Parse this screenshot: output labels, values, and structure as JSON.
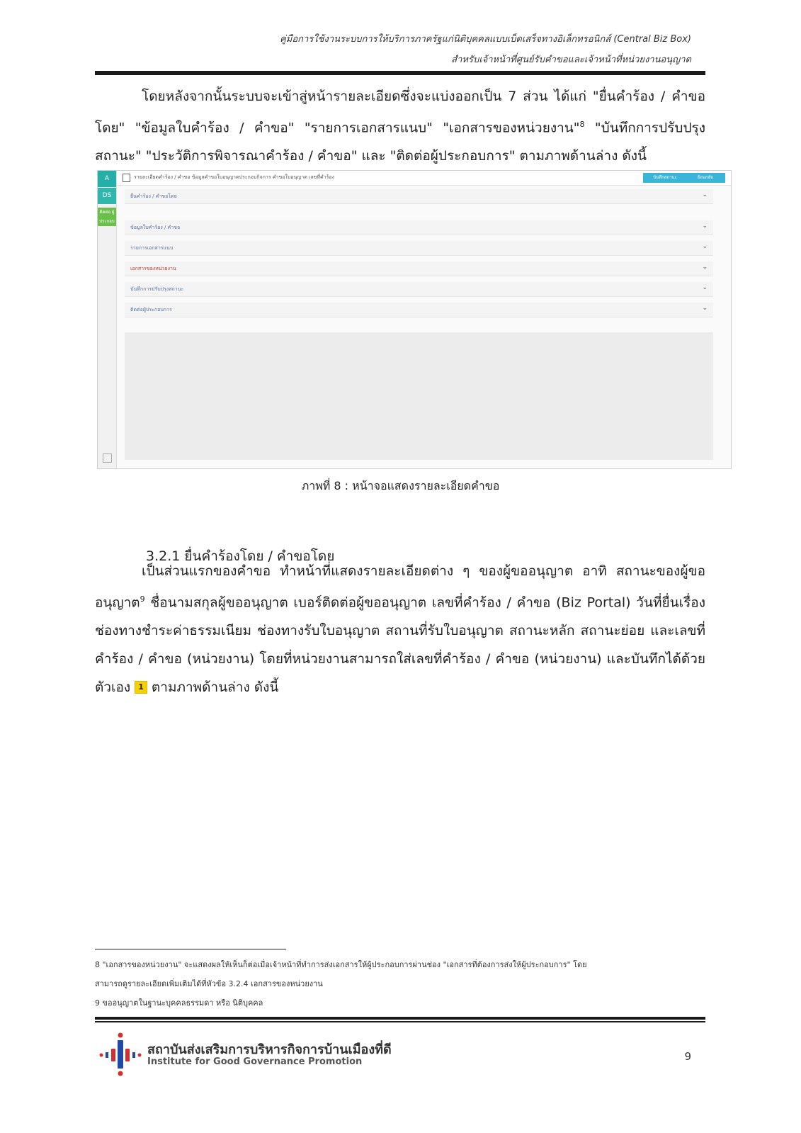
{
  "header": {
    "line1": "คู่มือการใช้งานระบบการให้บริการภาครัฐแก่นิติบุคคลแบบเบ็ดเสร็จทางอิเล็กทรอนิกส์ (Central Biz Box)",
    "line2": "สำหรับเจ้าหน้าที่ศูนย์รับคำขอและเจ้าหน้าที่หน่วยงานอนุญาต"
  },
  "intro_paragraph": "โดยหลังจากนั้นระบบจะเข้าสู่หน้ารายละเอียดซึ่งจะแบ่งออกเป็น 7 ส่วน ได้แก่ \"ยื่นคำร้อง / คำขอโดย\" \"ข้อมูลใบคำร้อง / คำขอ\" \"รายการเอกสารแนบ\" \"เอกสารของหน่วยงาน\"",
  "intro_footnote_mark": "8",
  "intro_paragraph_tail": " \"บันทึกการปรับปรุงสถานะ\" \"ประวัติการพิจารณาคำร้อง / คำขอ\" และ \"ติดต่อผู้ประกอบการ\" ตามภาพด้านล่าง ดังนี้",
  "screenshot": {
    "sidebar": [
      "A",
      "DS",
      "ติดต่อ ผู้ประกอบ"
    ],
    "title_text": "รายละเอียดคำร้อง / คำขอ ข้อมูลคำขอใบอนุญาตประกอบกิจการ คำขอใบอนุญาต เลขที่คำร้อง",
    "top_buttons": [
      "บันทึกสถานะ",
      "ย้อนกลับ"
    ],
    "sections": [
      "ยื่นคำร้อง / คำขอโดย",
      "ข้อมูลใบคำร้อง / คำขอ",
      "รายการเอกสารแนบ",
      "เอกสารของหน่วยงาน",
      "บันทึกการปรับปรุงสถานะ",
      "ติดต่อผู้ประกอบการ"
    ]
  },
  "figure_caption": "ภาพที่ 8 : หน้าจอแสดงรายละเอียดคำขอ",
  "section_heading": "3.2.1 ยื่นคำร้องโดย / คำขอโดย",
  "body_paragraph_part1": "เป็นส่วนแรกของคำขอ ทำหน้าที่แสดงรายละเอียดต่าง ๆ ของผู้ขออนุญาต อาทิ สถานะของผู้ขออนุญาต",
  "body_footnote_mark": "9",
  "body_paragraph_part2": " ชื่อนามสกุลผู้ขออนุญาต เบอร์ติดต่อผู้ขออนุญาต เลขที่คำร้อง / คำขอ (Biz Portal) วันที่ยื่นเรื่อง ช่องทางชำระค่าธรรมเนียม ช่องทางรับใบอนุญาต สถานที่รับใบอนุญาต สถานะหลัก สถานะย่อย และเลขที่คำร้อง / คำขอ (หน่วยงาน) โดยที่หน่วยงานสามารถใส่เลขที่คำร้อง / คำขอ (หน่วยงาน) และบันทึกได้ด้วยตัวเอง ",
  "badge": "1",
  "body_paragraph_end": " ตามภาพด้านล่าง  ดังนี้",
  "footnotes": {
    "fn8_line1": "8 \"เอกสารของหน่วยงาน\" จะแสดงผลให้เห็นก็ต่อเมื่อเจ้าหน้าที่ทำการส่งเอกสารให้ผู้ประกอบการผ่านช่อง \"เอกสารที่ต้องการส่งให้ผู้ประกอบการ\" โดย",
    "fn8_line2": "สามารถดูรายละเอียดเพิ่มเติมได้ที่หัวข้อ 3.2.4 เอกสารของหน่วยงาน",
    "fn9": "9 ขออนุญาตในฐานะบุคคลธรรมดา หรือ นิติบุคคล"
  },
  "footer": {
    "org_th": "สถาบันส่งเสริมการบริหารกิจการบ้านเมืองที่ดี",
    "org_en": "Institute for Good Governance Promotion",
    "page_number": "9"
  }
}
